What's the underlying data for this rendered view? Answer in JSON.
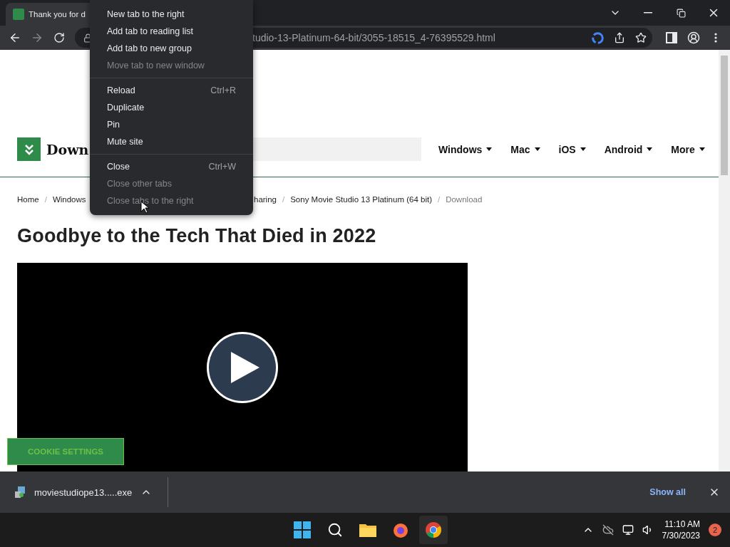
{
  "browser": {
    "tab": {
      "title": "Thank you for d"
    },
    "address": "tudio-13-Platinum-64-bit/3055-18515_4-76395529.html"
  },
  "context_menu": [
    {
      "kind": "item",
      "label": "New tab to the right",
      "disabled": false
    },
    {
      "kind": "item",
      "label": "Add tab to reading list",
      "disabled": false
    },
    {
      "kind": "item",
      "label": "Add tab to new group",
      "disabled": false
    },
    {
      "kind": "item",
      "label": "Move tab to new window",
      "disabled": true
    },
    {
      "kind": "separator"
    },
    {
      "kind": "item",
      "label": "Reload",
      "shortcut": "Ctrl+R",
      "disabled": false
    },
    {
      "kind": "item",
      "label": "Duplicate",
      "disabled": false
    },
    {
      "kind": "item",
      "label": "Pin",
      "disabled": false
    },
    {
      "kind": "item",
      "label": "Mute site",
      "disabled": false
    },
    {
      "kind": "separator"
    },
    {
      "kind": "item",
      "label": "Close",
      "shortcut": "Ctrl+W",
      "disabled": false
    },
    {
      "kind": "item",
      "label": "Close other tabs",
      "disabled": true
    },
    {
      "kind": "item",
      "label": "Close tabs to the right",
      "disabled": true
    }
  ],
  "site": {
    "logo_text": "Down",
    "nav": [
      {
        "label": "Windows"
      },
      {
        "label": "Mac"
      },
      {
        "label": "iOS"
      },
      {
        "label": "Android"
      },
      {
        "label": "More"
      }
    ],
    "breadcrumbs": {
      "separator": "/",
      "left": [
        {
          "label": "Home",
          "current": false
        },
        {
          "label": "Windows",
          "current": false
        }
      ],
      "right": [
        {
          "label": "haring",
          "current": false
        },
        {
          "label": "Sony Movie Studio 13 Platinum (64 bit)",
          "current": false
        },
        {
          "label": "Download",
          "current": true
        }
      ]
    },
    "headline": "Goodbye to the Tech That Died in 2022",
    "cookie_button": "COOKIE SETTINGS"
  },
  "download_bar": {
    "file": "moviestudiope13.....exe",
    "show_all": "Show all"
  },
  "taskbar": {
    "time": "11:10 AM",
    "date": "7/30/2023",
    "notifications": "2"
  }
}
